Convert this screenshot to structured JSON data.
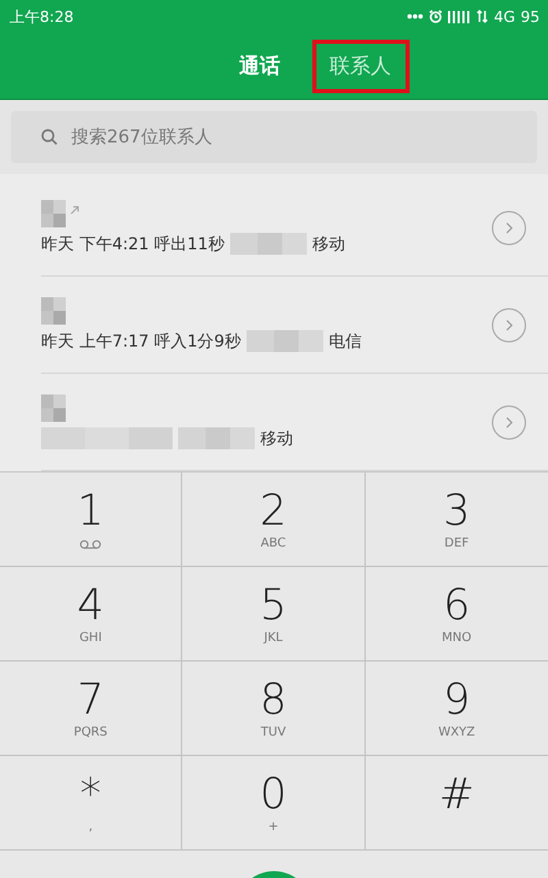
{
  "status_bar": {
    "time": "上午8:28",
    "network": "4G",
    "battery": "95"
  },
  "tabs": [
    {
      "label": "通话",
      "selected": true,
      "highlighted": false
    },
    {
      "label": "联系人",
      "selected": false,
      "highlighted": true
    }
  ],
  "search": {
    "placeholder": "搜索267位联系人"
  },
  "calls": [
    {
      "detail": "昨天 下午4:21 呼出11秒",
      "carrier": "移动",
      "outgoing": true
    },
    {
      "detail": "昨天 上午7:17 呼入1分9秒",
      "carrier": "电信",
      "outgoing": false
    },
    {
      "carrier": "移动",
      "outgoing": false
    }
  ],
  "keypad": [
    {
      "digit": "1",
      "kind": "voicemail"
    },
    {
      "digit": "2",
      "letters": "ABC",
      "kind": "letters"
    },
    {
      "digit": "3",
      "letters": "DEF",
      "kind": "letters"
    },
    {
      "digit": "4",
      "letters": "GHI",
      "kind": "letters"
    },
    {
      "digit": "5",
      "letters": "JKL",
      "kind": "letters"
    },
    {
      "digit": "6",
      "letters": "MNO",
      "kind": "letters"
    },
    {
      "digit": "7",
      "letters": "PQRS",
      "kind": "letters"
    },
    {
      "digit": "8",
      "letters": "TUV",
      "kind": "letters"
    },
    {
      "digit": "9",
      "letters": "WXYZ",
      "kind": "letters"
    },
    {
      "digit": "*",
      "letters": ",",
      "kind": "letters"
    },
    {
      "digit": "0",
      "letters": "+",
      "kind": "letters"
    },
    {
      "digit": "#",
      "kind": "plain"
    }
  ]
}
